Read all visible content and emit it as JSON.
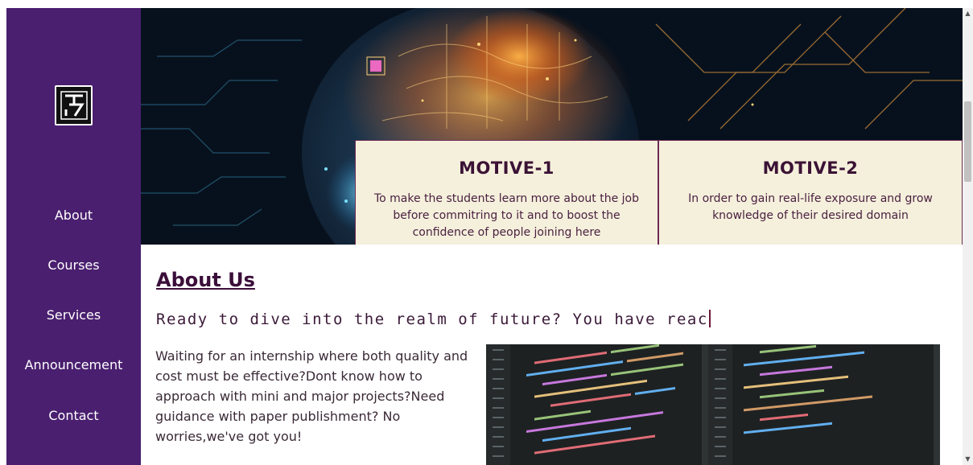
{
  "logo": {
    "icon": "brand-logo-icon",
    "text": "T 17"
  },
  "nav": {
    "items": [
      {
        "label": "About"
      },
      {
        "label": "Courses"
      },
      {
        "label": "Services"
      },
      {
        "label": "Announcement"
      },
      {
        "label": "Contact"
      }
    ]
  },
  "hero": {
    "motives": [
      {
        "title": "MOTIVE-1",
        "text": "To make the students learn more about the job before commitring to it and to boost the confidence of people joining here"
      },
      {
        "title": "MOTIVE-2",
        "text": "In order to gain real-life exposure and grow knowledge of their desired domain"
      }
    ]
  },
  "about": {
    "title": "About Us",
    "tagline": "Ready to dive into the realm of future? You have reac",
    "text": "Waiting for an internship where both quality and cost must be effective?Dont know how to approach with mini and major projects?Need guidance with paper publishment? No worries,we've got you!"
  },
  "colors": {
    "sidebar": "#4a1f6f",
    "card_bg": "#f5f0dc",
    "heading": "#3b0f3a"
  }
}
